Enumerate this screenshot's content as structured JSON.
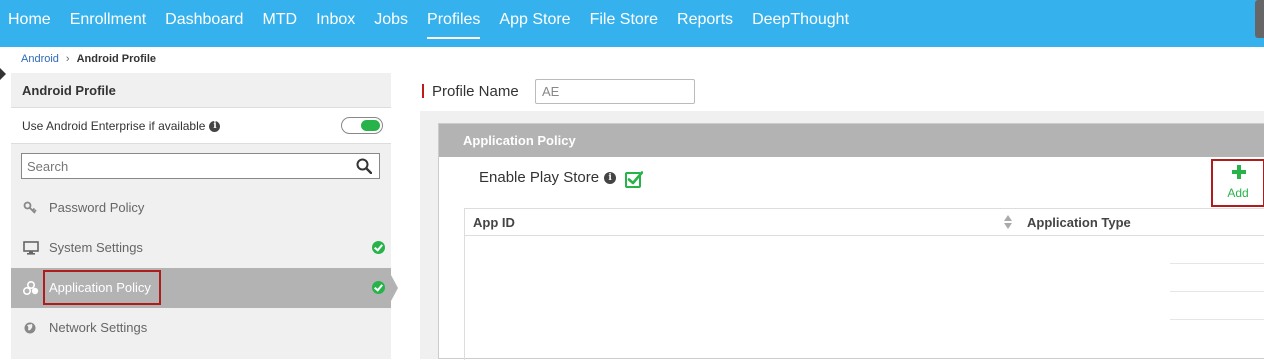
{
  "nav": {
    "items": [
      {
        "label": "Home",
        "active": false
      },
      {
        "label": "Enrollment",
        "active": false
      },
      {
        "label": "Dashboard",
        "active": false
      },
      {
        "label": "MTD",
        "active": false
      },
      {
        "label": "Inbox",
        "active": false
      },
      {
        "label": "Jobs",
        "active": false
      },
      {
        "label": "Profiles",
        "active": true
      },
      {
        "label": "App Store",
        "active": false
      },
      {
        "label": "File Store",
        "active": false
      },
      {
        "label": "Reports",
        "active": false
      },
      {
        "label": "DeepThought",
        "active": false
      }
    ]
  },
  "breadcrumb": {
    "parent": "Android",
    "current": "Android Profile"
  },
  "sidebar": {
    "title": "Android Profile",
    "enterprise_label": "Use Android Enterprise if available",
    "enterprise_enabled": true,
    "search_placeholder": "Search",
    "items": [
      {
        "label": "Password Policy",
        "icon": "key-icon",
        "configured": false,
        "active": false
      },
      {
        "label": "System Settings",
        "icon": "monitor-icon",
        "configured": true,
        "active": false
      },
      {
        "label": "Application Policy",
        "icon": "apps-icon",
        "configured": true,
        "active": true
      },
      {
        "label": "Network Settings",
        "icon": "globe-icon",
        "configured": false,
        "active": false
      }
    ]
  },
  "profile": {
    "name_label": "Profile Name",
    "name_value": "AE"
  },
  "policy": {
    "header": "Application Policy",
    "play_store_label": "Enable Play Store",
    "play_store_enabled": true,
    "add_label": "Add",
    "columns": [
      "App ID",
      "Application Type"
    ]
  },
  "colors": {
    "nav_bg": "#35b2ee",
    "accent_green": "#27b34a",
    "highlight_red": "#b01c1c",
    "section_gray": "#b3b3b3"
  }
}
